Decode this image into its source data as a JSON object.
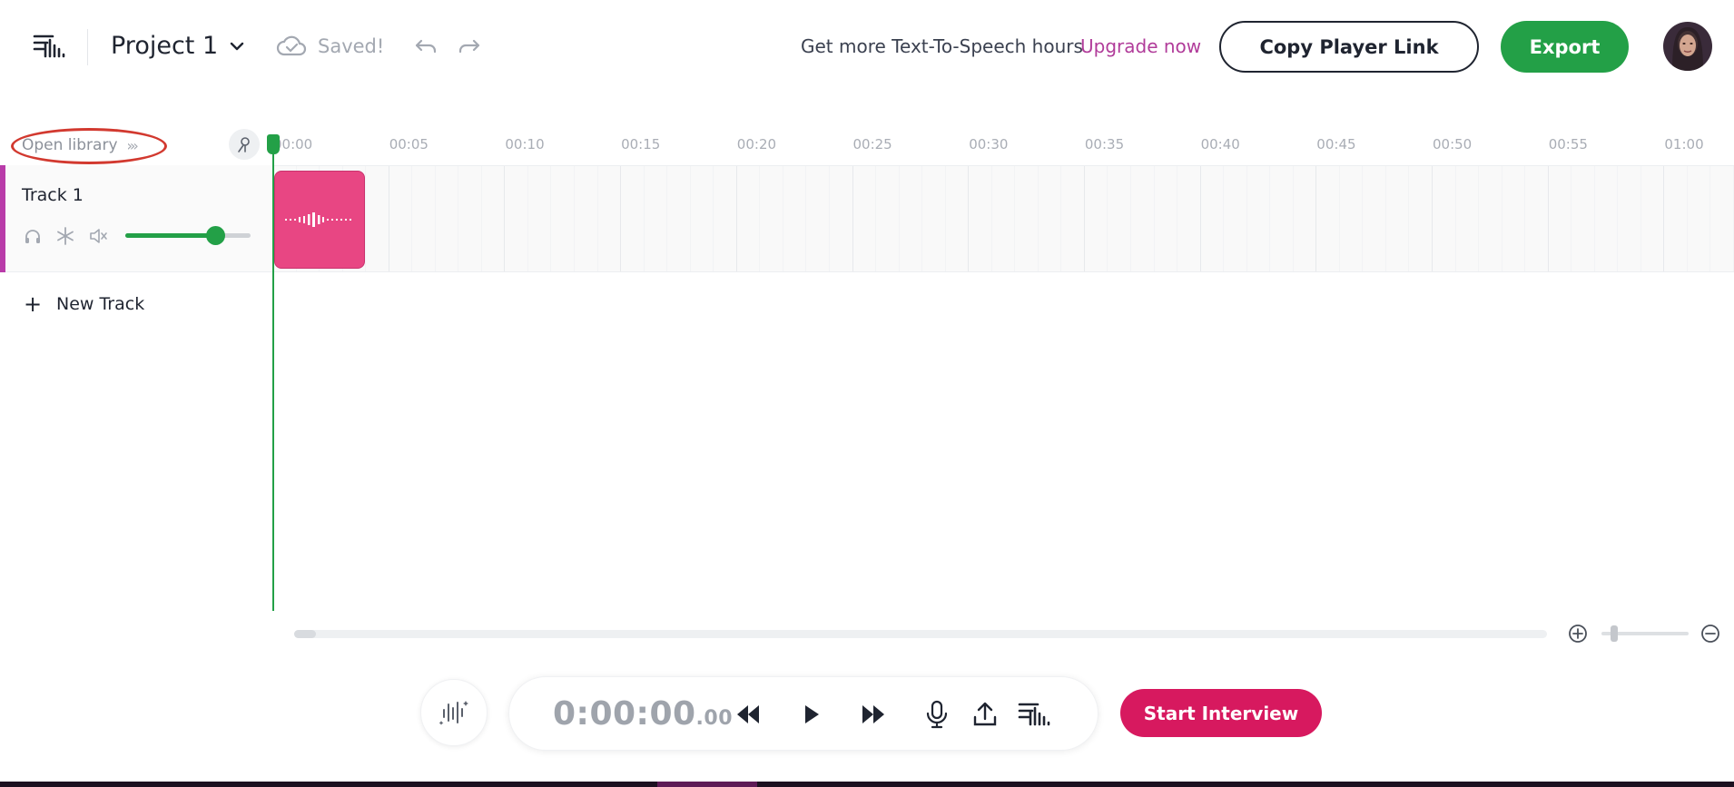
{
  "header": {
    "project_name": "Project 1",
    "save_status": "Saved!",
    "tts_promo": "Get more Text-To-Speech hours",
    "upgrade_label": "Upgrade now",
    "copy_link_label": "Copy Player Link",
    "export_label": "Export"
  },
  "library": {
    "open_label": "Open library"
  },
  "ruler": {
    "ticks": [
      "00:00",
      "00:05",
      "00:10",
      "00:15",
      "00:20",
      "00:25",
      "00:30",
      "00:35",
      "00:40",
      "00:45",
      "00:50",
      "00:55",
      "01:00"
    ]
  },
  "tracks": [
    {
      "name": "Track 1",
      "volume": 0.72
    }
  ],
  "new_track_label": "New Track",
  "transport": {
    "time_main": "0:00:00",
    "time_frac": ".00"
  },
  "start_interview_label": "Start Interview",
  "colors": {
    "green": "#23a047",
    "pink_clip": "#e84683",
    "interview": "#d7195f",
    "upgrade": "#b13c9a",
    "track_accent": "#b93ba9"
  }
}
